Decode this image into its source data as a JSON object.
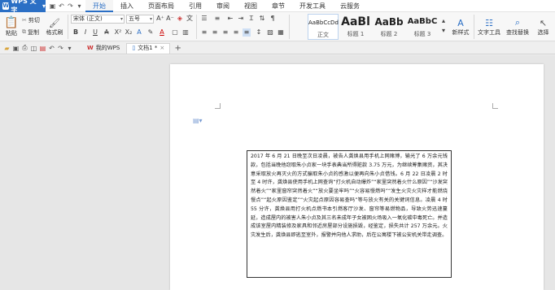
{
  "app": {
    "name": "WPS 文字"
  },
  "menu": {
    "tabs": [
      "开始",
      "插入",
      "页面布局",
      "引用",
      "审阅",
      "视图",
      "章节",
      "开发工具",
      "云服务"
    ],
    "active": "开始"
  },
  "ribbon": {
    "paste": "粘贴",
    "cut": "剪切",
    "copy": "复制",
    "format_painter": "格式刷",
    "font_name": "宋体 (正文)",
    "font_size": "五号",
    "styles": [
      {
        "sample": "AaBbCcDd",
        "name": "正文"
      },
      {
        "sample": "AaBl",
        "name": "标题 1"
      },
      {
        "sample": "AaBb",
        "name": "标题 2"
      },
      {
        "sample": "AaBbC",
        "name": "标题 3"
      }
    ],
    "new_style": "新样式",
    "text_tools": "文字工具",
    "find_replace": "查找替换",
    "select": "选择"
  },
  "tabs": {
    "home": "我的WPS",
    "doc": "文档1 *"
  },
  "document": {
    "text": "2017 年 6 月 21 日晚至次日凌晨，被告人龚焕县用手机上网赌博，输光了 6 万余元钱款，包括当晚他窃取朱小贞家一块手表典当所得赃款 3.75 万元，为继续筹集赌资，其决意采取放火再灭火的方式骗取朱小贞的感激以便再向朱小贞借钱。6 月 22 日凌晨 2 时至 4 时许，龚焕县使用手机上网查询“打火机自动爆炸”“家里突然着火什么原因”“沙发突然着火”“家里窗帘突然着火”“放火要坐牢吗”“火容易慢燃吗”“发生火灾火灾样才能燃烧慢点”“起火原因鉴定”“火灾起点原因容易查吗”等与放火有关的关键词信息。凌晨 4 时 55 分许，龚焕县用打火机点燃书本引燃客厅沙发、窗帘等易燃物品，导致火势迅速蔓延，造成屋内的被害人朱小贞及其三名未成年子女被困火场吸入一氧化碳中毒死亡。并造成该室屋内精装修及家具和邻近房屋部分设施损毁，经鉴定，损失共计 257 万余元。火灾发生后，龚焕县即逃至室外，报警并向他人求助，后在公寓楼下被公安机关带走调查。"
  }
}
